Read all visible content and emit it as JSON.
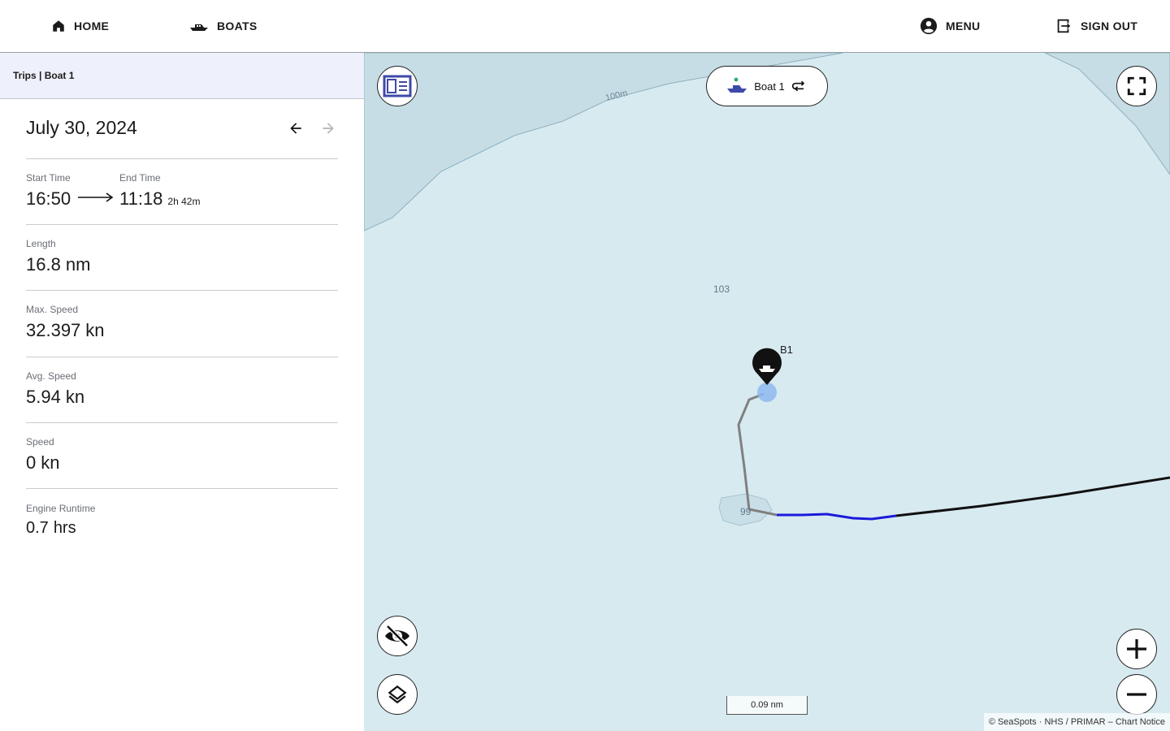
{
  "nav": {
    "home": "HOME",
    "boats": "BOATS",
    "menu": "MENU",
    "signout": "SIGN OUT"
  },
  "sidebar": {
    "header": "Trips | Boat 1",
    "date": "July 30, 2024",
    "start_label": "Start Time",
    "start_time": "16:50",
    "end_label": "End Time",
    "end_time": "11:18",
    "duration": "2h 42m",
    "stats": [
      {
        "label": "Length",
        "value": "16.8",
        "unit": "nm"
      },
      {
        "label": "Max. Speed",
        "value": "32.397",
        "unit": "kn"
      },
      {
        "label": "Avg. Speed",
        "value": "5.94",
        "unit": "kn"
      },
      {
        "label": "Speed",
        "value": "0",
        "unit": "kn"
      },
      {
        "label": "Engine Runtime",
        "value": "0.7",
        "unit": "hrs"
      }
    ]
  },
  "map": {
    "boat_selector": "Boat 1",
    "boat_marker_label": "B1",
    "contour_label": "100m",
    "depth_103": "103",
    "depth_99": "99",
    "scale": "0.09 nm",
    "attribution": "© SeaSpots · NHS / PRIMAR – Chart Notice"
  },
  "icons": [
    "home-icon",
    "boat-icon",
    "account-circle-icon",
    "logout-icon",
    "arrow-left-icon",
    "arrow-right-icon",
    "panel-toggle-icon",
    "fullscreen-icon",
    "visibility-off-icon",
    "layers-icon",
    "plus-icon",
    "minus-icon",
    "swap-icon"
  ],
  "colors": {
    "header_bg": "#eef0fc",
    "map_water": "#d7eaf0",
    "map_deep": "#c6dde6",
    "track_recent": "#1a1adb",
    "track_old": "#111111",
    "track_last": "#808080",
    "position_dot": "#8fb8f0"
  }
}
